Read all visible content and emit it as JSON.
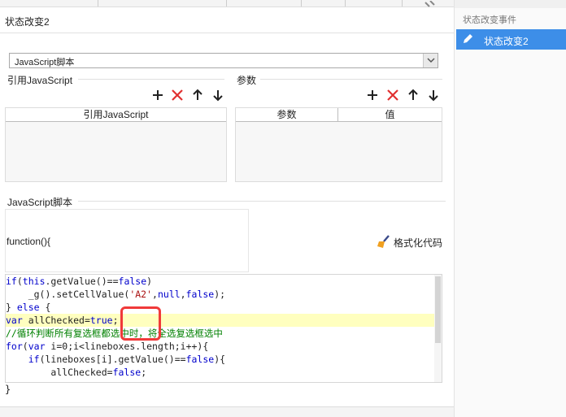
{
  "header": {
    "title": "状态改变2"
  },
  "script_type": {
    "selected": "JavaScript脚本"
  },
  "ref_js": {
    "section_label": "引用JavaScript",
    "columns": [
      "引用JavaScript"
    ]
  },
  "params": {
    "section_label": "参数",
    "columns": [
      "参数",
      "值"
    ]
  },
  "toolbar_icons": [
    "plus-icon",
    "delete-x-icon",
    "arrow-up-icon",
    "arrow-down-icon"
  ],
  "js_section": {
    "label": "JavaScript脚本",
    "function_header": "function(){",
    "format_button": "格式化代码",
    "closing_brace": "}"
  },
  "code_lines": [
    "if(this.getValue()==false)",
    "    _g().setCellValue('A2',null,false);",
    "} else {",
    "var allChecked=true;",
    "//循环判断所有复选框都选中时，将全选复选框选中",
    "for(var i=0;i<lineboxes.length;i++){",
    "    if(lineboxes[i].getValue()==false){",
    "        allChecked=false;"
  ],
  "right_panel": {
    "event_label": "状态改变事件",
    "selected_item": "状态改变2"
  },
  "colors": {
    "accent": "#3d8ee8",
    "delete": "#e03030",
    "callout": "#f03a3a",
    "highlight_line": "#ffffbf"
  }
}
